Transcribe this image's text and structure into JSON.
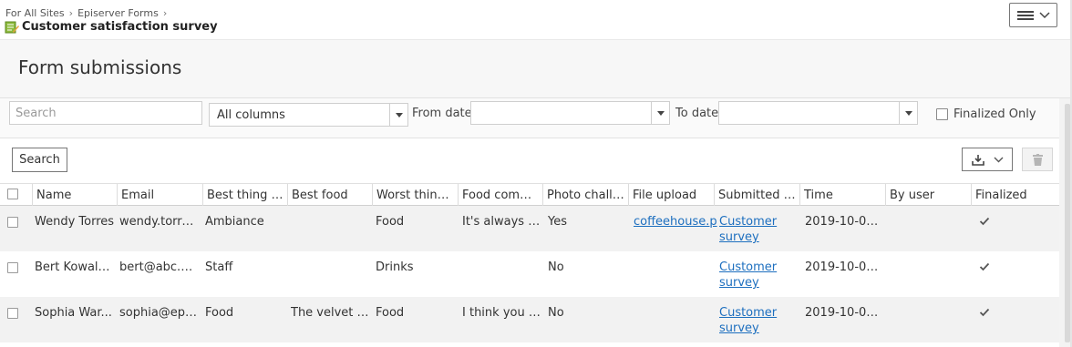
{
  "breadcrumb": [
    "For All Sites",
    "Episerver Forms"
  ],
  "form_title": "Customer satisfaction survey",
  "page_heading": "Form submissions",
  "filters": {
    "search_placeholder": "Search",
    "columns_select": "All columns",
    "from_label": "From date",
    "to_label": "To date",
    "finalized_only_label": "Finalized Only",
    "finalized_only_checked": false
  },
  "actions": {
    "search_label": "Search"
  },
  "table": {
    "columns": [
      "Name",
      "Email",
      "Best thing a...",
      "Best food",
      "Worst thing ...",
      "Food compl...",
      "Photo challe...",
      "File upload",
      "Submitted f...",
      "Time",
      "By user",
      "Finalized"
    ],
    "rows": [
      {
        "name": "Wendy Torres",
        "email": "wendy.torre...",
        "best_thing": "Ambiance",
        "best_food": "",
        "worst_thing": "Food",
        "food_compl": "It's always to...",
        "photo": "Yes",
        "file": "coffeehouse.p",
        "submitted_from": "Customer survey",
        "time": "2019-10-01, 1...",
        "by_user": "",
        "finalized": true
      },
      {
        "name": "Bert Kowale...",
        "email": "bert@abc.c...",
        "best_thing": "Staff",
        "best_food": "",
        "worst_thing": "Drinks",
        "food_compl": "",
        "photo": "No",
        "file": "",
        "submitted_from": "Customer survey",
        "time": "2019-10-01, 1...",
        "by_user": "",
        "finalized": true
      },
      {
        "name": "Sophia War...",
        "email": "sophia@epi...",
        "best_thing": "Food",
        "best_food": "The velvet c...",
        "worst_thing": "Food",
        "food_compl": "I think you s...",
        "photo": "No",
        "file": "",
        "submitted_from": "Customer survey",
        "time": "2019-10-01, 1...",
        "by_user": "",
        "finalized": true
      }
    ]
  },
  "icons": {
    "form": "form-icon",
    "menu": "hamburger-menu-icon",
    "export": "download-icon",
    "delete": "trash-icon",
    "finalized": "checkmark-icon"
  },
  "colors": {
    "link": "#1d6fbf",
    "alt_row": "#f2f2f2"
  }
}
